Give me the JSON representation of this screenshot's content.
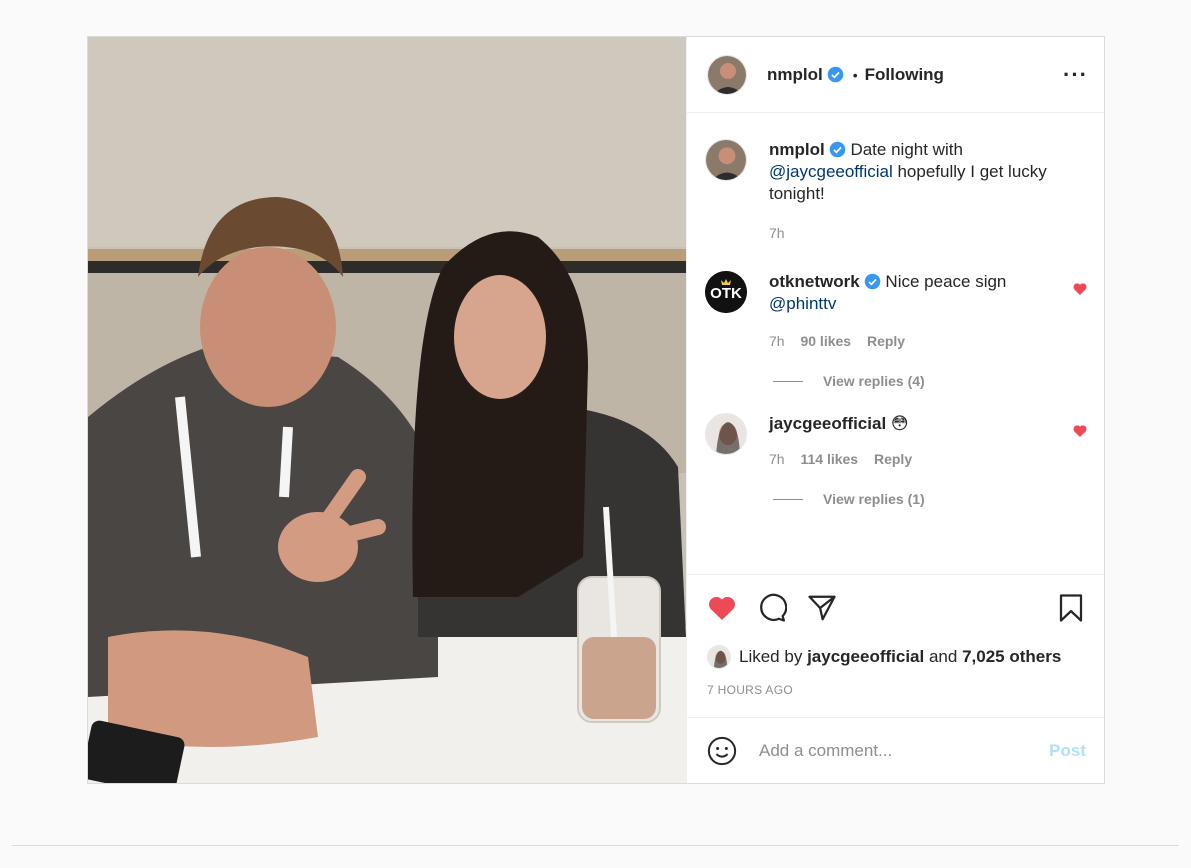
{
  "post": {
    "author": "nmplol",
    "follow_status": "Following",
    "separator": "•",
    "more_icon": "more-horizontal-icon",
    "caption": {
      "username": "nmplol",
      "text_before": "Date night with",
      "mention": "@jaycgeeofficial",
      "text_after": "hopefully I get lucky tonight!",
      "time": "7h"
    },
    "comments": [
      {
        "username": "otknetwork",
        "verified": true,
        "text": "Nice peace sign",
        "mention": "@phinttv",
        "time": "7h",
        "likes": "90 likes",
        "reply": "Reply",
        "view_replies": "View replies (4)"
      },
      {
        "username": "jaycgeeofficial",
        "verified": false,
        "text": "😳",
        "time": "7h",
        "likes": "114 likes",
        "reply": "Reply",
        "view_replies": "View replies (1)"
      }
    ],
    "liked_by_prefix": "Liked by",
    "liked_by_user": "jaycgeeofficial",
    "liked_by_and": "and",
    "liked_by_others": "7,025 others",
    "timestamp": "7 HOURS AGO",
    "comment_placeholder": "Add a comment...",
    "post_button": "Post",
    "colors": {
      "heart": "#ed4956",
      "verified": "#3897f0",
      "link": "#00376b",
      "post_disabled": "#b2dffc"
    }
  }
}
